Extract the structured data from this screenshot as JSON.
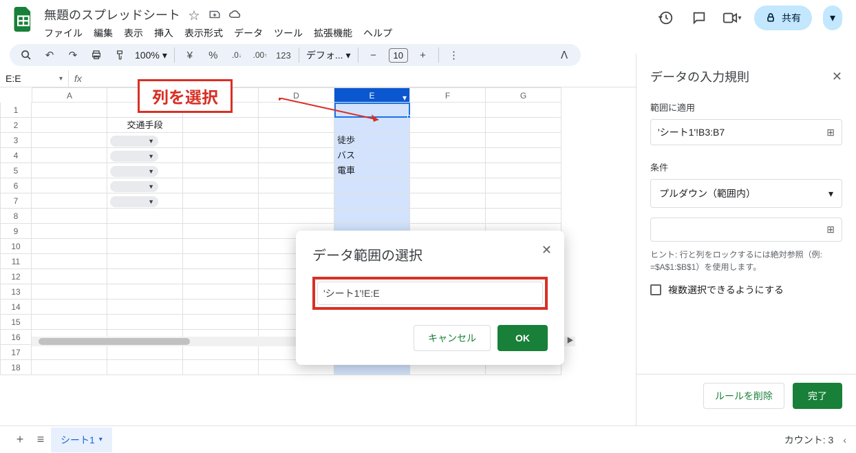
{
  "doc_title": "無題のスプレッドシート",
  "menubar": [
    "ファイル",
    "編集",
    "表示",
    "挿入",
    "表示形式",
    "データ",
    "ツール",
    "拡張機能",
    "ヘルプ"
  ],
  "share_label": "共有",
  "toolbar": {
    "zoom": "100%",
    "currency": "¥",
    "percent": "%",
    "dec_dec": ".0",
    "inc_dec": ".00",
    "num": "123",
    "font": "デフォ...",
    "font_size": "10"
  },
  "namebox": "E:E",
  "columns": [
    "A",
    "B",
    "C",
    "D",
    "E",
    "F",
    "G"
  ],
  "rows_count": 18,
  "cells": {
    "b2": "交通手段",
    "e3": "徒歩",
    "e4": "バス",
    "e5": "電車"
  },
  "annotation": "列を選択",
  "dialog": {
    "title": "データ範囲の選択",
    "input": "'シート1'!E:E",
    "cancel": "キャンセル",
    "ok": "OK"
  },
  "sidepanel": {
    "title": "データの入力規則",
    "range_label": "範囲に適用",
    "range_value": "'シート1'!B3:B7",
    "condition_label": "条件",
    "condition_value": "プルダウン（範囲内）",
    "hint": "ヒント: 行と列をロックするには絶対参照（例: =$A$1:$B$1）を使用します。",
    "multi_label": "複数選択できるようにする",
    "delete": "ルールを削除",
    "done": "完了"
  },
  "sheet_tab": "シート1",
  "status": "カウント: 3"
}
